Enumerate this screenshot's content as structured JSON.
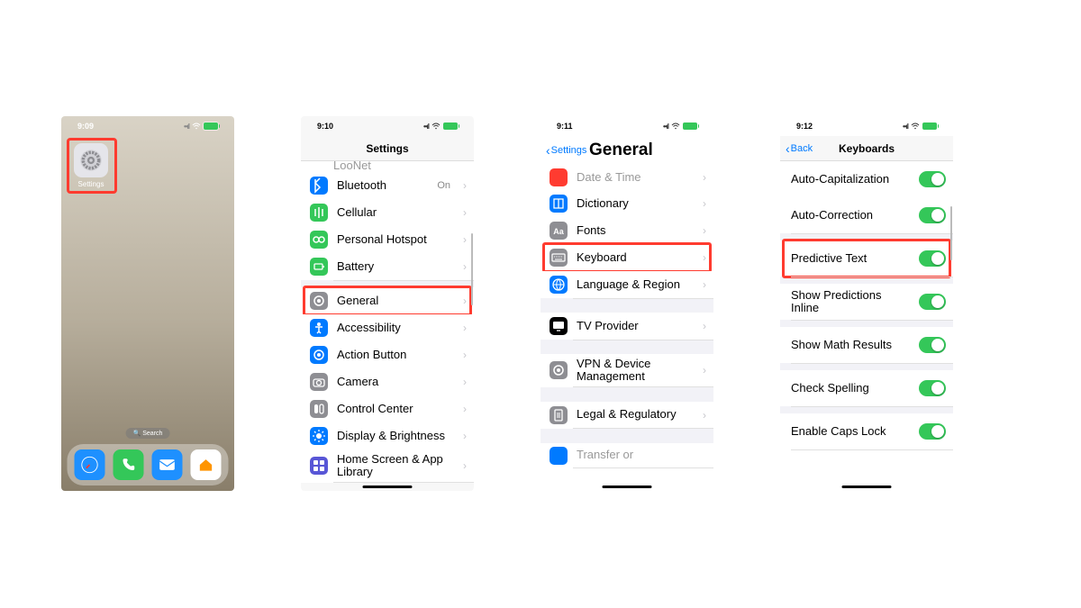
{
  "screens": [
    {
      "time": "9:09",
      "app_label": "Settings",
      "search_label": "Search",
      "dock": [
        "safari",
        "phone",
        "mail",
        "home"
      ]
    },
    {
      "time": "9:10",
      "title": "Settings",
      "rows": [
        {
          "label": "Bluetooth",
          "sub": "On",
          "color": "#007aff",
          "icon": "bt"
        },
        {
          "label": "Cellular",
          "color": "#34c759",
          "icon": "ant"
        },
        {
          "label": "Personal Hotspot",
          "color": "#34c759",
          "icon": "link"
        },
        {
          "label": "Battery",
          "color": "#34c759",
          "icon": "batt"
        },
        {
          "label": "General",
          "color": "#8e8e93",
          "icon": "gear",
          "highlight": true
        },
        {
          "label": "Accessibility",
          "color": "#007aff",
          "icon": "acc"
        },
        {
          "label": "Action Button",
          "color": "#007aff",
          "icon": "action"
        },
        {
          "label": "Camera",
          "color": "#8e8e93",
          "icon": "cam"
        },
        {
          "label": "Control Center",
          "color": "#8e8e93",
          "icon": "cc"
        },
        {
          "label": "Display & Brightness",
          "color": "#007aff",
          "icon": "sun"
        },
        {
          "label": "Home Screen & App Library",
          "color": "#5856d6",
          "icon": "grid"
        }
      ]
    },
    {
      "time": "9:11",
      "back": "Settings",
      "title": "General",
      "rows": [
        {
          "label": "Dictionary",
          "color": "#007aff",
          "icon": "book"
        },
        {
          "label": "Fonts",
          "color": "#8e8e93",
          "icon": "Aa"
        },
        {
          "label": "Keyboard",
          "color": "#8e8e93",
          "icon": "kb",
          "highlight": true
        },
        {
          "label": "Language & Region",
          "color": "#007aff",
          "icon": "globe"
        },
        {
          "gap": true
        },
        {
          "label": "TV Provider",
          "color": "#000",
          "icon": "tv"
        },
        {
          "gap": true
        },
        {
          "label": "VPN & Device Management",
          "color": "#8e8e93",
          "icon": "gear"
        },
        {
          "gap": true
        },
        {
          "label": "Legal & Regulatory",
          "color": "#8e8e93",
          "icon": "doc"
        }
      ]
    },
    {
      "time": "9:12",
      "back": "Back",
      "title": "Keyboards",
      "rows": [
        {
          "label": "Auto-Capitalization",
          "toggle": true
        },
        {
          "label": "Auto-Correction",
          "toggle": true
        },
        {
          "label": "Predictive Text",
          "toggle": true,
          "highlight": true
        },
        {
          "label": "Show Predictions Inline",
          "toggle": true
        },
        {
          "label": "Show Math Results",
          "toggle": true
        },
        {
          "label": "Check Spelling",
          "toggle": true
        },
        {
          "label": "Enable Caps Lock",
          "toggle": true
        }
      ]
    }
  ]
}
